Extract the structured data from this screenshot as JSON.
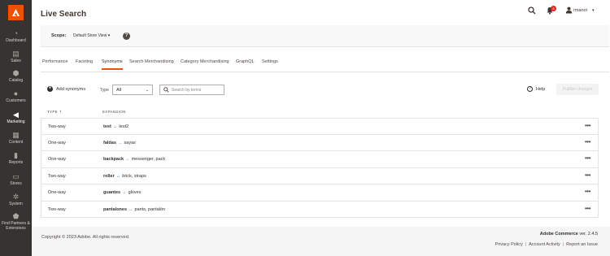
{
  "header": {
    "title": "Live Search",
    "notification_count": "8",
    "user": "rmanor"
  },
  "sidebar": {
    "items": [
      {
        "label": "Dashboard",
        "icon": "dashboard-icon"
      },
      {
        "label": "Sales",
        "icon": "dollar-icon"
      },
      {
        "label": "Catalog",
        "icon": "box-icon"
      },
      {
        "label": "Customers",
        "icon": "users-icon"
      },
      {
        "label": "Marketing",
        "icon": "megaphone-icon"
      },
      {
        "label": "Content",
        "icon": "layout-icon"
      },
      {
        "label": "Reports",
        "icon": "bar-chart-icon"
      },
      {
        "label": "Stores",
        "icon": "store-icon"
      },
      {
        "label": "System",
        "icon": "gear-icon"
      },
      {
        "label": "Find Partners & Extensions",
        "icon": "partners-icon"
      }
    ]
  },
  "scope": {
    "label": "Scope:",
    "value": "Default Store View",
    "help": "?"
  },
  "tabs": [
    "Performance",
    "Faceting",
    "Synonyms",
    "Search Merchandising",
    "Category Merchandising",
    "GraphQL",
    "Settings"
  ],
  "active_tab": "Synonyms",
  "toolbar": {
    "add_label": "Add synonyms",
    "type_label": "Type",
    "type_value": "All",
    "search_placeholder": "Search by terms",
    "help_label": "Help",
    "publish_label": "Publish changes"
  },
  "table": {
    "headers": {
      "type": "TYPE",
      "expansion": "EXPANSION"
    },
    "rows": [
      {
        "type": "Two-way",
        "term": "test",
        "arrow": "↔",
        "synonyms": "test2"
      },
      {
        "type": "One-way",
        "term": "faldas",
        "arrow": "→",
        "synonyms": "sayas"
      },
      {
        "type": "One-way",
        "term": "backpack",
        "arrow": "→",
        "synonyms": "messenger, pack"
      },
      {
        "type": "Two-way",
        "term": "roller",
        "arrow": "↔",
        "synonyms": "brick, straps"
      },
      {
        "type": "One-way",
        "term": "guantes",
        "arrow": "→",
        "synonyms": "gloves"
      },
      {
        "type": "Two-way",
        "term": "pantalones",
        "arrow": "↔",
        "synonyms": "pants, pantalón"
      }
    ]
  },
  "footer": {
    "copyright": "Copyright © 2023 Adobe. All rights reserved.",
    "brand": "Adobe Commerce",
    "version": "ver. 2.4.5",
    "links": [
      "Privacy Policy",
      "Account Activity",
      "Report an Issue"
    ]
  },
  "colors": {
    "sidebar_bg": "#373330",
    "accent": "#eb5202",
    "arrow_blue": "#3f7cd5",
    "footer_bg": "#f5f5f5"
  }
}
